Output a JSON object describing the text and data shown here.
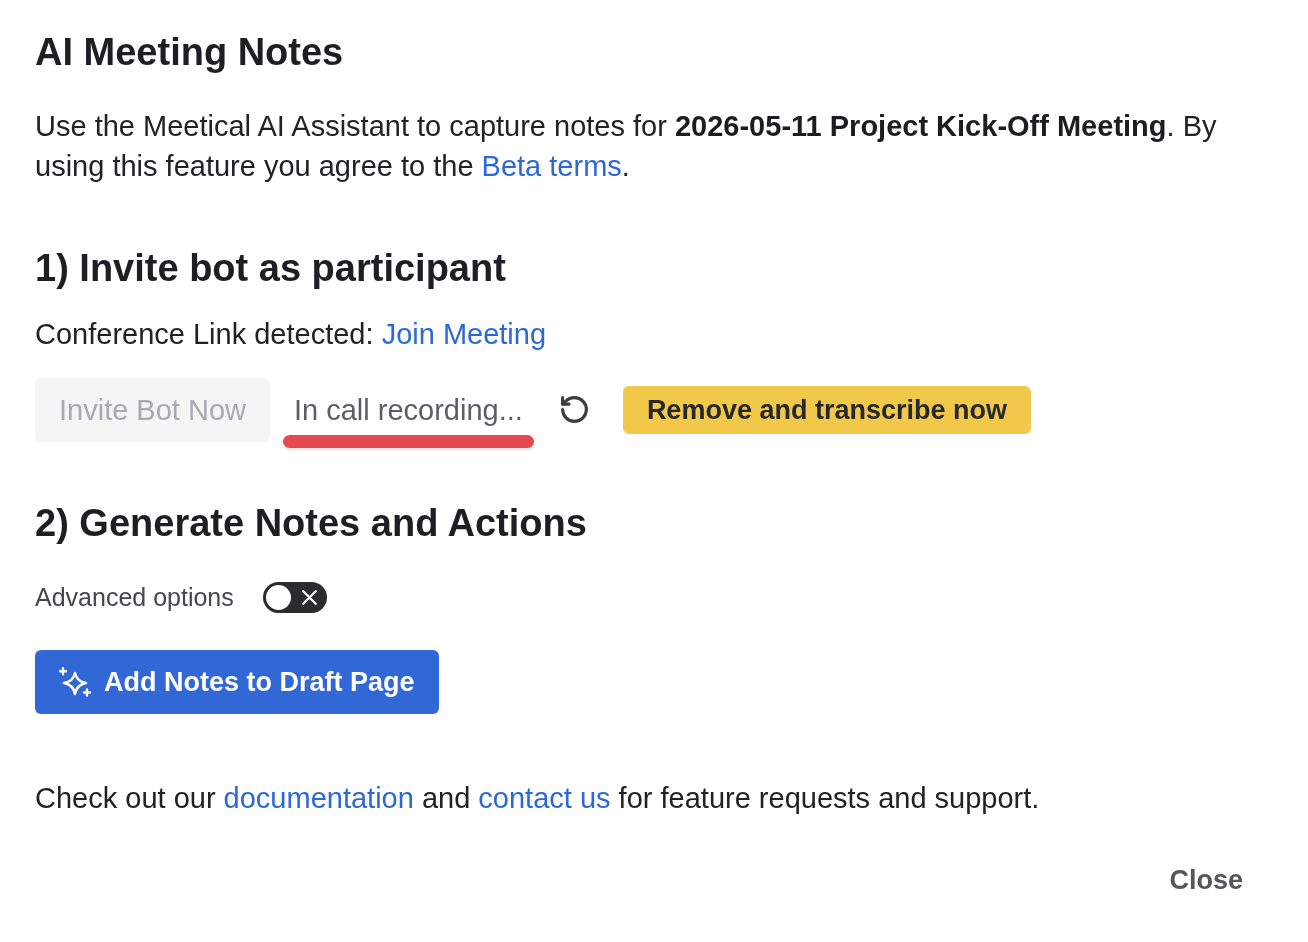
{
  "dialog": {
    "title": "AI Meeting Notes"
  },
  "intro": [
    {
      "kind": "text",
      "text": "Use the Meetical AI Assistant to capture notes for **2026-05-11 Project Kick-Off Meeting**. By using this feature you agree to the "
    },
    {
      "kind": "link",
      "text": "Beta terms"
    },
    {
      "kind": "text",
      "text": "."
    }
  ],
  "step_1": {
    "heading": "1) Invite bot as participant",
    "conference_link": [
      {
        "kind": "text",
        "text": "Conference Link detected: "
      },
      {
        "kind": "link",
        "text": "Join Meeting"
      }
    ],
    "invite_button": {
      "label": "Invite Bot Now",
      "disabled": true
    },
    "recording_status": {
      "text": "In call recording...",
      "active": true
    },
    "remove_button": {
      "label": "Remove and transcribe now"
    }
  },
  "step_2": {
    "heading": "2) Generate Notes and Actions",
    "advanced_options": {
      "label": "Advanced options",
      "on": false
    },
    "add_notes_button": {
      "label": "Add Notes to Draft Page"
    }
  },
  "footer": [
    {
      "kind": "text",
      "text": "Check out our "
    },
    {
      "kind": "link",
      "text": "documentation"
    },
    {
      "kind": "text",
      "text": " and "
    },
    {
      "kind": "link",
      "text": "contact us"
    },
    {
      "kind": "text",
      "text": " for feature requests and support."
    }
  ],
  "close_button": {
    "label": "Close"
  }
}
